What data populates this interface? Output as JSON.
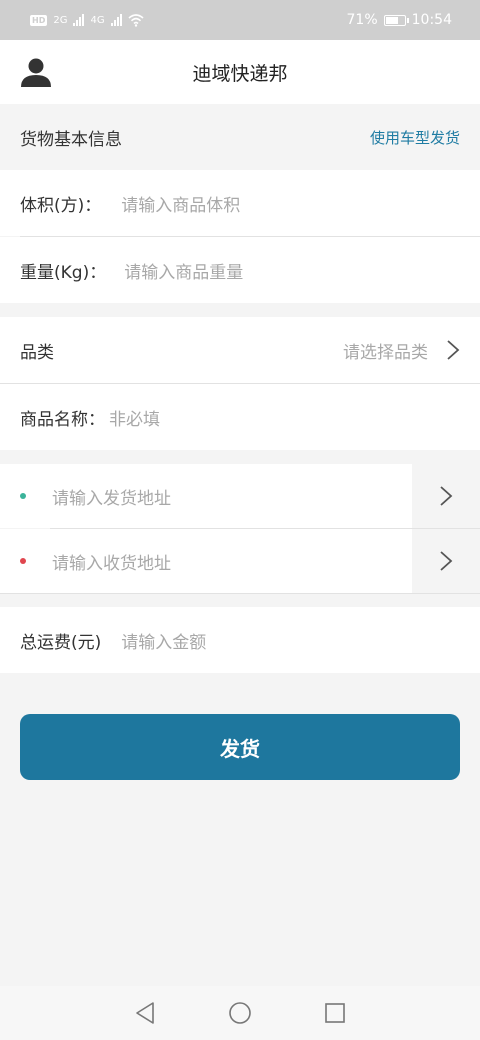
{
  "status_bar": {
    "left_indicators": [
      "HD",
      "2G",
      "4G"
    ],
    "battery": "71%",
    "battery_level": 0.71,
    "time": "10:54"
  },
  "header": {
    "title": "迪域快递邦",
    "user_icon": "user-icon"
  },
  "cargo_section": {
    "heading": "货物基本信息",
    "vehicle_link": "使用车型发货"
  },
  "volume": {
    "label": "体积(方)：",
    "placeholder": "请输入商品体积"
  },
  "weight": {
    "label": "重量(Kg)：",
    "placeholder": "请输入商品重量"
  },
  "category": {
    "label": "品类",
    "placeholder": "请选择品类"
  },
  "product_name": {
    "label": "商品名称：",
    "placeholder": "非必填"
  },
  "send_address": {
    "placeholder": "请输入发货地址",
    "dot_color": "#3bb39a"
  },
  "receive_address": {
    "placeholder": "请输入收货地址",
    "dot_color": "#e0464e"
  },
  "freight": {
    "label": "总运费(元)",
    "placeholder": "请输入金额"
  },
  "submit": {
    "label": "发货",
    "color": "#1e779e"
  },
  "colors": {
    "accent": "#1f7ca3",
    "background": "#f4f4f4"
  },
  "nav_bar": {
    "icons": [
      "back-triangle-icon",
      "home-circle-icon",
      "recents-square-icon"
    ]
  }
}
